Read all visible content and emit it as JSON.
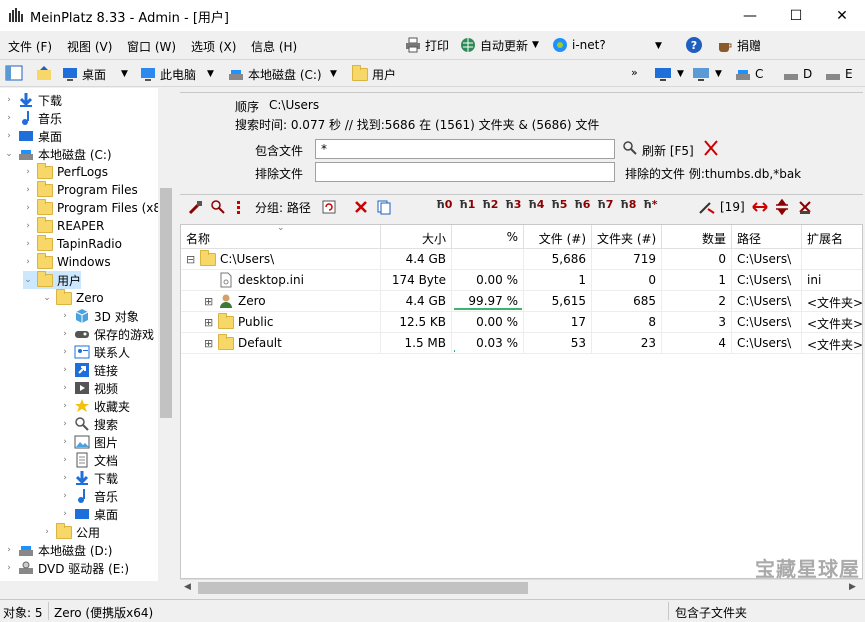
{
  "window": {
    "title": "MeinPlatz 8.33 - Admin - [用户]"
  },
  "menu": [
    "文件 (F)",
    "视图 (V)",
    "窗口 (W)",
    "选项 (X)",
    "信息 (H)"
  ],
  "toolbar": {
    "print": "打印",
    "autoupdate": "自动更新",
    "inet": "i-net?",
    "donate": "捐赠"
  },
  "address": {
    "desktop": "桌面",
    "thispc": "此电脑",
    "localdisk": "本地磁盘 (C:)",
    "users": "用户",
    "drives": [
      "C",
      "D",
      "E"
    ]
  },
  "tree": [
    {
      "label": "下载",
      "level": 0,
      "icon": "download-icon"
    },
    {
      "label": "音乐",
      "level": 0,
      "icon": "music-icon"
    },
    {
      "label": "桌面",
      "level": 0,
      "icon": "desktop-icon"
    },
    {
      "label": "本地磁盘 (C:)",
      "level": 0,
      "icon": "drive-icon",
      "expanded": true
    },
    {
      "label": "PerfLogs",
      "level": 1,
      "icon": "folder-icon"
    },
    {
      "label": "Program Files",
      "level": 1,
      "icon": "folder-icon"
    },
    {
      "label": "Program Files (x8",
      "level": 1,
      "icon": "folder-icon"
    },
    {
      "label": "REAPER",
      "level": 1,
      "icon": "folder-icon"
    },
    {
      "label": "TapinRadio",
      "level": 1,
      "icon": "folder-icon"
    },
    {
      "label": "Windows",
      "level": 1,
      "icon": "folder-icon"
    },
    {
      "label": "用户",
      "level": 1,
      "icon": "folder-icon",
      "expanded": true,
      "selected": true
    },
    {
      "label": "Zero",
      "level": 2,
      "icon": "folder-icon",
      "expanded": true
    },
    {
      "label": "3D 对象",
      "level": 3,
      "icon": "cube-icon"
    },
    {
      "label": "保存的游戏",
      "level": 3,
      "icon": "games-icon"
    },
    {
      "label": "联系人",
      "level": 3,
      "icon": "contacts-icon"
    },
    {
      "label": "链接",
      "level": 3,
      "icon": "link-icon"
    },
    {
      "label": "视频",
      "level": 3,
      "icon": "video-icon"
    },
    {
      "label": "收藏夹",
      "level": 3,
      "icon": "star-icon"
    },
    {
      "label": "搜索",
      "level": 3,
      "icon": "search-icon"
    },
    {
      "label": "图片",
      "level": 3,
      "icon": "picture-icon"
    },
    {
      "label": "文档",
      "level": 3,
      "icon": "document-icon"
    },
    {
      "label": "下载",
      "level": 3,
      "icon": "download-icon"
    },
    {
      "label": "音乐",
      "level": 3,
      "icon": "music-icon"
    },
    {
      "label": "桌面",
      "level": 3,
      "icon": "desktop-icon"
    },
    {
      "label": "公用",
      "level": 2,
      "icon": "folder-icon"
    },
    {
      "label": "本地磁盘 (D:)",
      "level": 0,
      "icon": "drive-icon"
    },
    {
      "label": "DVD 驱动器 (E:)",
      "level": 0,
      "icon": "dvd-icon"
    }
  ],
  "search": {
    "order_label": "顺序",
    "order_value": "C:\\Users",
    "time_text": "搜索时间: 0.077 秒 //  找到:5686 在 (1561) 文件夹 & (5686) 文件",
    "include_label": "包含文件",
    "include_value": "*",
    "exclude_label": "排除文件",
    "exclude_value": "",
    "refresh": "刷新 [F5]",
    "exclude_hint": "排除的文件 例:thumbs.db,*bak"
  },
  "toolbar2": {
    "group": "分组: 路径",
    "count": "[19]"
  },
  "grid": {
    "columns": [
      "名称",
      "大小",
      "%",
      "文件 (#)",
      "文件夹 (#)",
      "数量",
      "路径",
      "扩展名"
    ],
    "rows": [
      {
        "name": "C:\\Users\\",
        "size": "4.4 GB",
        "pct": "",
        "files": "5,686",
        "folders": "719",
        "count": "0",
        "path": "C:\\Users\\",
        "ext": "",
        "icon": "folder-icon",
        "expander": "⊟",
        "indent": 0
      },
      {
        "name": "desktop.ini",
        "size": "174 Byte",
        "pct": "0.00 %",
        "files": "1",
        "folders": "0",
        "count": "1",
        "path": "C:\\Users\\",
        "ext": "ini",
        "icon": "file-icon",
        "expander": "",
        "indent": 1,
        "bar": 0
      },
      {
        "name": "Zero",
        "size": "4.4 GB",
        "pct": "99.97 %",
        "files": "5,615",
        "folders": "685",
        "count": "2",
        "path": "C:\\Users\\",
        "ext": "<文件夹>",
        "icon": "user-icon",
        "expander": "⊞",
        "indent": 1,
        "bar": 99.97
      },
      {
        "name": "Public",
        "size": "12.5 KB",
        "pct": "0.00 %",
        "files": "17",
        "folders": "8",
        "count": "3",
        "path": "C:\\Users\\",
        "ext": "<文件夹>",
        "icon": "folder-icon",
        "expander": "⊞",
        "indent": 1,
        "bar": 0
      },
      {
        "name": "Default",
        "size": "1.5 MB",
        "pct": "0.03 %",
        "files": "53",
        "folders": "23",
        "count": "4",
        "path": "C:\\Users\\",
        "ext": "<文件夹>",
        "icon": "folder-icon",
        "expander": "⊞",
        "indent": 1,
        "bar": 0.03
      }
    ]
  },
  "status": {
    "objects": "对象: 5",
    "user": "Zero (便携版x64)",
    "right": "包含子文件夹"
  },
  "watermark": "宝藏星球屋"
}
